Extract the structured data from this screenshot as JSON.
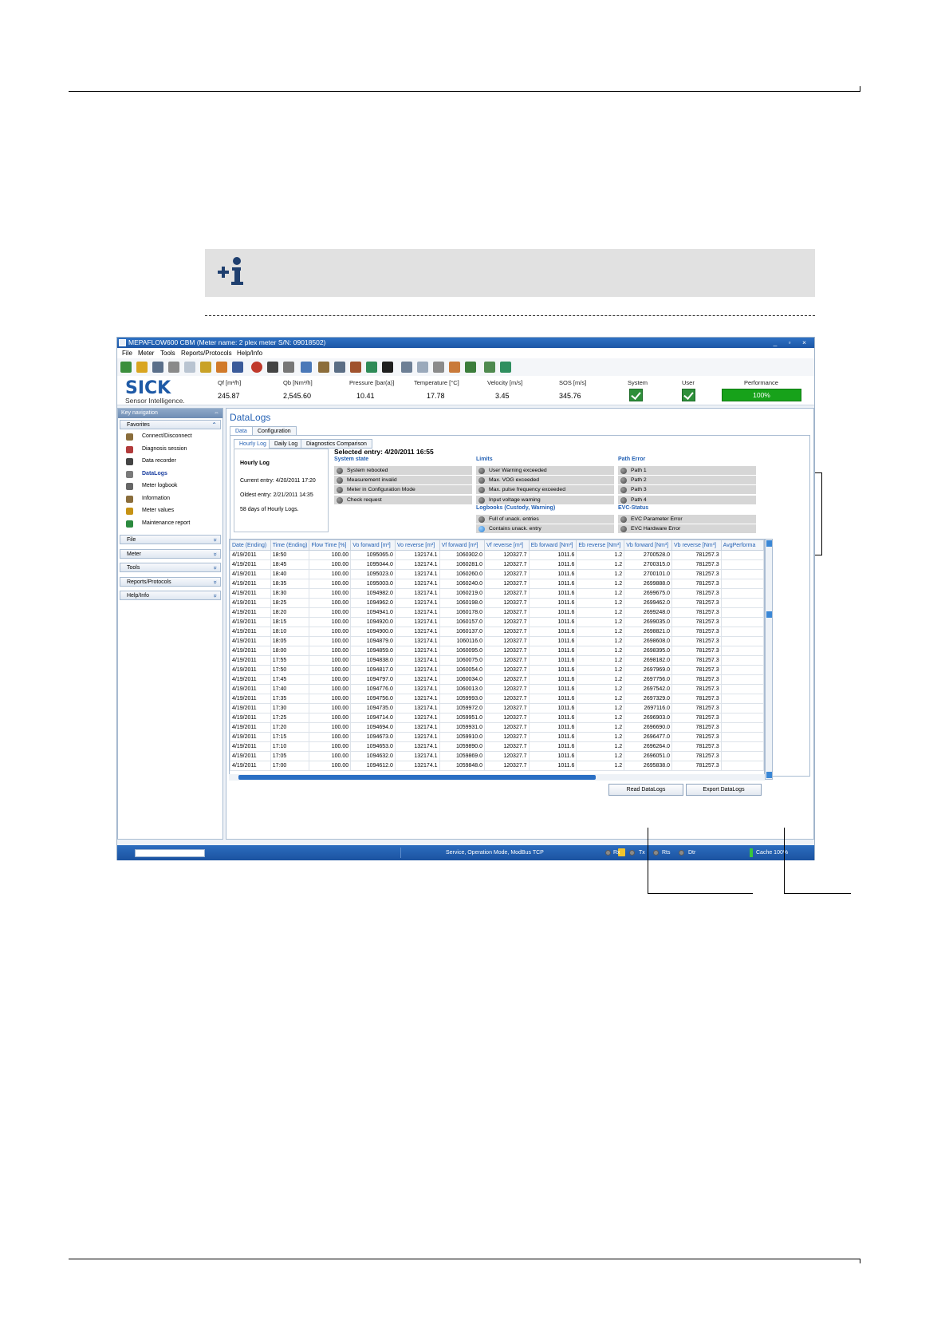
{
  "window": {
    "title": "MEPAFLOW600 CBM (Meter name: 2 plex meter S/N: 09018502)",
    "controls": "_ ▫ ×"
  },
  "menu": [
    "File",
    "Meter",
    "Tools",
    "Reports/Protocols",
    "Help/Info"
  ],
  "header": {
    "logo": "SICK",
    "tagline": "Sensor Intelligence.",
    "measurements": [
      {
        "label": "Qf [m³/h]",
        "value": "245.87"
      },
      {
        "label": "Qb [Nm³/h]",
        "value": "2,545.60"
      },
      {
        "label": "Pressure [bar(a)]",
        "value": "10.41"
      },
      {
        "label": "Temperature [°C]",
        "value": "17.78"
      },
      {
        "label": "Velocity [m/s]",
        "value": "3.45"
      },
      {
        "label": "SOS [m/s]",
        "value": "345.76"
      }
    ],
    "system_label": "System",
    "user_label": "User",
    "performance_label": "Performance",
    "performance_value": "100%",
    "performance_fraction": 1.0
  },
  "sidebar": {
    "header": "Key navigation",
    "pin": "⇔",
    "favorites_title": "Favorites",
    "favorites": [
      {
        "label": "Connect/Disconnect",
        "icon": "plug-icon",
        "color": "#8a6d3b"
      },
      {
        "label": "Diagnosis session",
        "icon": "diagnosis-icon",
        "color": "#b23b3b"
      },
      {
        "label": "Data recorder",
        "icon": "recorder-icon",
        "color": "#444444"
      },
      {
        "label": "DataLogs",
        "icon": "datalogs-icon",
        "color": "#7a7a7a"
      },
      {
        "label": "Meter logbook",
        "icon": "logbook-icon",
        "color": "#666666"
      },
      {
        "label": "Information",
        "icon": "information-icon",
        "color": "#8a6d3b"
      },
      {
        "label": "Meter values",
        "icon": "meter-values-icon",
        "color": "#c69214"
      },
      {
        "label": "Maintenance report",
        "icon": "report-icon",
        "color": "#2b8a3e"
      }
    ],
    "groups": [
      "File",
      "Meter",
      "Tools",
      "Reports/Protocols",
      "Help/Info"
    ]
  },
  "content": {
    "title": "DataLogs",
    "tabs": [
      "Data",
      "Configuration"
    ],
    "subtabs": [
      "Hourly Log",
      "Daily Log",
      "Diagnostics Comparison"
    ],
    "summary": {
      "title": "Hourly Log",
      "current": "Current entry: 4/20/2011 17:20",
      "oldest": "Oldest entry: 2/21/2011 14:35",
      "days": "58 days of Hourly Logs."
    },
    "selected_entry": "Selected entry: 4/20/2011 16:55",
    "system_state": {
      "title": "System state",
      "items": [
        "System rebooted",
        "Measurement invalid",
        "Meter in Configuration Mode",
        "Check request"
      ]
    },
    "limits": {
      "title": "Limits",
      "items": [
        "User Warning exceeded",
        "Max. VOG exceeded",
        "Max. pulse frequency exceeded",
        "Input voltage warning"
      ]
    },
    "logbooks": {
      "title": "Logbooks (Custody, Warning)",
      "items": [
        "Full of unack. entries",
        "Contains unack. entry"
      ]
    },
    "path_error": {
      "title": "Path Error",
      "items": [
        "Path 1",
        "Path 2",
        "Path 3",
        "Path 4"
      ]
    },
    "evc_status": {
      "title": "EVC-Status",
      "items": [
        "EVC Parameter Error",
        "EVC Hardware Error"
      ]
    },
    "table": {
      "columns": [
        "Date (Ending)",
        "Time (Ending)",
        "Flow Time [%]",
        "Vo forward [m³]",
        "Vo reverse [m³]",
        "Vf forward [m³]",
        "Vf reverse [m³]",
        "Eb forward [Nm³]",
        "Eb reverse [Nm³]",
        "Vb forward [Nm³]",
        "Vb reverse [Nm³]",
        "AvgPerforma"
      ],
      "rows": [
        [
          "4/19/2011",
          "18:50",
          "100.00",
          "1095065.0",
          "132174.1",
          "1060302.0",
          "120327.7",
          "1011.6",
          "1.2",
          "2700528.0",
          "781257.3"
        ],
        [
          "4/19/2011",
          "18:45",
          "100.00",
          "1095044.0",
          "132174.1",
          "1060281.0",
          "120327.7",
          "1011.6",
          "1.2",
          "2700315.0",
          "781257.3"
        ],
        [
          "4/19/2011",
          "18:40",
          "100.00",
          "1095023.0",
          "132174.1",
          "1060260.0",
          "120327.7",
          "1011.6",
          "1.2",
          "2700101.0",
          "781257.3"
        ],
        [
          "4/19/2011",
          "18:35",
          "100.00",
          "1095003.0",
          "132174.1",
          "1060240.0",
          "120327.7",
          "1011.6",
          "1.2",
          "2699888.0",
          "781257.3"
        ],
        [
          "4/19/2011",
          "18:30",
          "100.00",
          "1094982.0",
          "132174.1",
          "1060219.0",
          "120327.7",
          "1011.6",
          "1.2",
          "2699675.0",
          "781257.3"
        ],
        [
          "4/19/2011",
          "18:25",
          "100.00",
          "1094962.0",
          "132174.1",
          "1060198.0",
          "120327.7",
          "1011.6",
          "1.2",
          "2699462.0",
          "781257.3"
        ],
        [
          "4/19/2011",
          "18:20",
          "100.00",
          "1094941.0",
          "132174.1",
          "1060178.0",
          "120327.7",
          "1011.6",
          "1.2",
          "2699248.0",
          "781257.3"
        ],
        [
          "4/19/2011",
          "18:15",
          "100.00",
          "1094920.0",
          "132174.1",
          "1060157.0",
          "120327.7",
          "1011.6",
          "1.2",
          "2699035.0",
          "781257.3"
        ],
        [
          "4/19/2011",
          "18:10",
          "100.00",
          "1094900.0",
          "132174.1",
          "1060137.0",
          "120327.7",
          "1011.6",
          "1.2",
          "2698821.0",
          "781257.3"
        ],
        [
          "4/19/2011",
          "18:05",
          "100.00",
          "1094879.0",
          "132174.1",
          "1060116.0",
          "120327.7",
          "1011.6",
          "1.2",
          "2698608.0",
          "781257.3"
        ],
        [
          "4/19/2011",
          "18:00",
          "100.00",
          "1094859.0",
          "132174.1",
          "1060095.0",
          "120327.7",
          "1011.6",
          "1.2",
          "2698395.0",
          "781257.3"
        ],
        [
          "4/19/2011",
          "17:55",
          "100.00",
          "1094838.0",
          "132174.1",
          "1060075.0",
          "120327.7",
          "1011.6",
          "1.2",
          "2698182.0",
          "781257.3"
        ],
        [
          "4/19/2011",
          "17:50",
          "100.00",
          "1094817.0",
          "132174.1",
          "1060054.0",
          "120327.7",
          "1011.6",
          "1.2",
          "2697969.0",
          "781257.3"
        ],
        [
          "4/19/2011",
          "17:45",
          "100.00",
          "1094797.0",
          "132174.1",
          "1060034.0",
          "120327.7",
          "1011.6",
          "1.2",
          "2697756.0",
          "781257.3"
        ],
        [
          "4/19/2011",
          "17:40",
          "100.00",
          "1094776.0",
          "132174.1",
          "1060013.0",
          "120327.7",
          "1011.6",
          "1.2",
          "2697542.0",
          "781257.3"
        ],
        [
          "4/19/2011",
          "17:35",
          "100.00",
          "1094756.0",
          "132174.1",
          "1059993.0",
          "120327.7",
          "1011.6",
          "1.2",
          "2697329.0",
          "781257.3"
        ],
        [
          "4/19/2011",
          "17:30",
          "100.00",
          "1094735.0",
          "132174.1",
          "1059972.0",
          "120327.7",
          "1011.6",
          "1.2",
          "2697116.0",
          "781257.3"
        ],
        [
          "4/19/2011",
          "17:25",
          "100.00",
          "1094714.0",
          "132174.1",
          "1059951.0",
          "120327.7",
          "1011.6",
          "1.2",
          "2696903.0",
          "781257.3"
        ],
        [
          "4/19/2011",
          "17:20",
          "100.00",
          "1094694.0",
          "132174.1",
          "1059931.0",
          "120327.7",
          "1011.6",
          "1.2",
          "2696690.0",
          "781257.3"
        ],
        [
          "4/19/2011",
          "17:15",
          "100.00",
          "1094673.0",
          "132174.1",
          "1059910.0",
          "120327.7",
          "1011.6",
          "1.2",
          "2696477.0",
          "781257.3"
        ],
        [
          "4/19/2011",
          "17:10",
          "100.00",
          "1094653.0",
          "132174.1",
          "1059890.0",
          "120327.7",
          "1011.6",
          "1.2",
          "2696264.0",
          "781257.3"
        ],
        [
          "4/19/2011",
          "17:05",
          "100.00",
          "1094632.0",
          "132174.1",
          "1059869.0",
          "120327.7",
          "1011.6",
          "1.2",
          "2696051.0",
          "781257.3"
        ],
        [
          "4/19/2011",
          "17:00",
          "100.00",
          "1094612.0",
          "132174.1",
          "1059848.0",
          "120327.7",
          "1011.6",
          "1.2",
          "2695838.0",
          "781257.3"
        ]
      ]
    },
    "buttons": {
      "read": "Read DataLogs",
      "export": "Export DataLogs"
    }
  },
  "statusbar": {
    "mode": "Service, Operation Mode, ModBus TCP",
    "leds": [
      "Rx",
      "Tx",
      "Rts",
      "Dtr"
    ],
    "cache": "Cache 100%"
  },
  "colors": {
    "accent": "#2461b4",
    "titlebar": "#1c56a6",
    "ok": "#2e8f3a",
    "performance": "#17a21a"
  }
}
